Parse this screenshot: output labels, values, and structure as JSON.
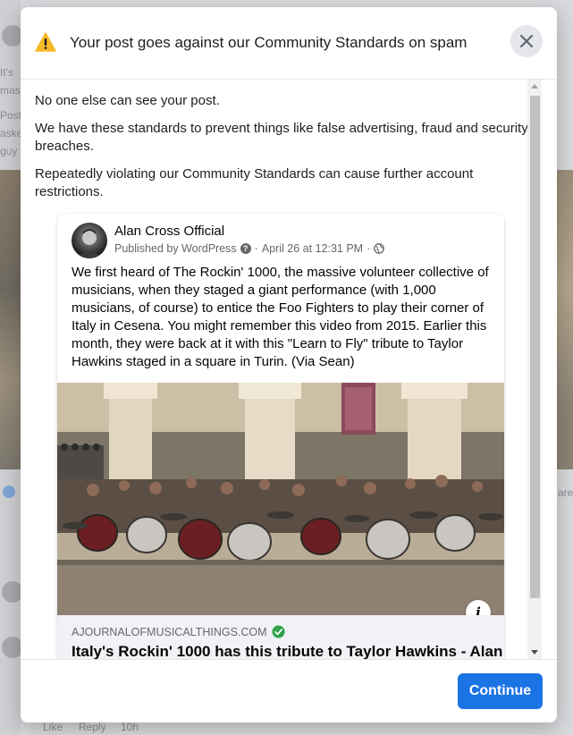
{
  "modal": {
    "title": "Your post goes against our Community Standards on spam",
    "close_icon": "close-icon",
    "warning_icon": "warning-triangle-icon",
    "accent_color": "#F7B928",
    "paragraphs": [
      "No one else can see your post.",
      "We have these standards to prevent things like false advertising, fraud and security breaches.",
      "Repeatedly violating our Community Standards can cause further account restrictions."
    ],
    "continue_label": "Continue",
    "button_color": "#1B74E4"
  },
  "post": {
    "author": "Alan Cross Official",
    "published_by": "Published by WordPress",
    "date": "April 26 at 12:31 PM",
    "separator": "·",
    "text": "We first heard of The Rockin' 1000, the massive volunteer collective of musicians, when they staged a giant performance (with 1,000 musicians, of course) to entice the Foo Fighters to play their corner of Italy in Cesena. You might remember this video from 2015. Earlier this month, they were back at it with this \"Learn to Fly\" tribute to Taylor Hawkins staged in a square in Turin. (Via Sean)",
    "info_label": "i",
    "link_domain": "AJOURNALOFMUSICALTHINGS.COM",
    "link_title": "Italy's Rockin' 1000 has this tribute to Taylor Hawkins - Alan"
  },
  "background": {
    "fragments": [
      "It's",
      "mas",
      "Post",
      "aske",
      "guy",
      "are",
      "Like",
      "Reply",
      "10h"
    ]
  }
}
